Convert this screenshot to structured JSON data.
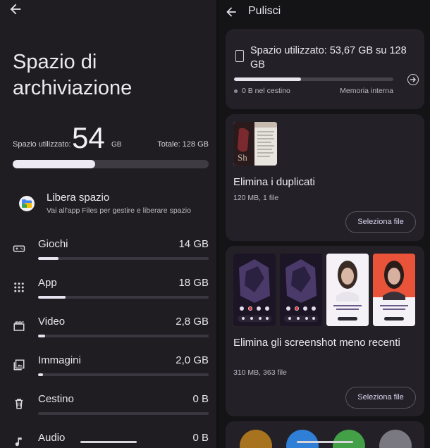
{
  "left": {
    "title": "Spazio di archiviazione",
    "used_label": "Spazio utilizzato:",
    "used_value": "54",
    "used_unit": "GB",
    "total_label": "Totale: 128 GB",
    "used_fraction": 0.42,
    "free": {
      "title": "Libera spazio",
      "subtitle": "Vai all'app Files per gestire e liberare spazio"
    },
    "categories": [
      {
        "name": "Giochi",
        "size": "14 GB",
        "fill": 0.12,
        "icon": "gamepad-icon"
      },
      {
        "name": "App",
        "size": "18 GB",
        "fill": 0.16,
        "icon": "apps-grid-icon"
      },
      {
        "name": "Video",
        "size": "2,8 GB",
        "fill": 0.04,
        "icon": "video-icon"
      },
      {
        "name": "Immagini",
        "size": "2,0 GB",
        "fill": 0.03,
        "icon": "image-icon"
      },
      {
        "name": "Cestino",
        "size": "0 B",
        "fill": 0,
        "icon": "trash-icon"
      },
      {
        "name": "Audio",
        "size": "0 B",
        "fill": 0,
        "icon": "music-note-icon"
      }
    ]
  },
  "right": {
    "title": "Pulisci",
    "storage": {
      "text": "Spazio utilizzato: 53,67 GB su 128 GB",
      "fraction": 0.42,
      "trash": "0 B nel cestino",
      "memory": "Memoria interna"
    },
    "duplicates": {
      "title": "Elimina i duplicati",
      "meta": "120 MB, 1 file",
      "button": "Seleziona file"
    },
    "screenshots": {
      "title": "Elimina gli screenshot meno recenti",
      "meta": "310 MB, 363 file",
      "button": "Seleziona file"
    }
  },
  "colors": {
    "left_bg": "#1f1d22",
    "right_bg": "#141316",
    "card_bg": "#232127",
    "bar_fill": "#ede9f3",
    "bar_track": "#3e3b43"
  }
}
